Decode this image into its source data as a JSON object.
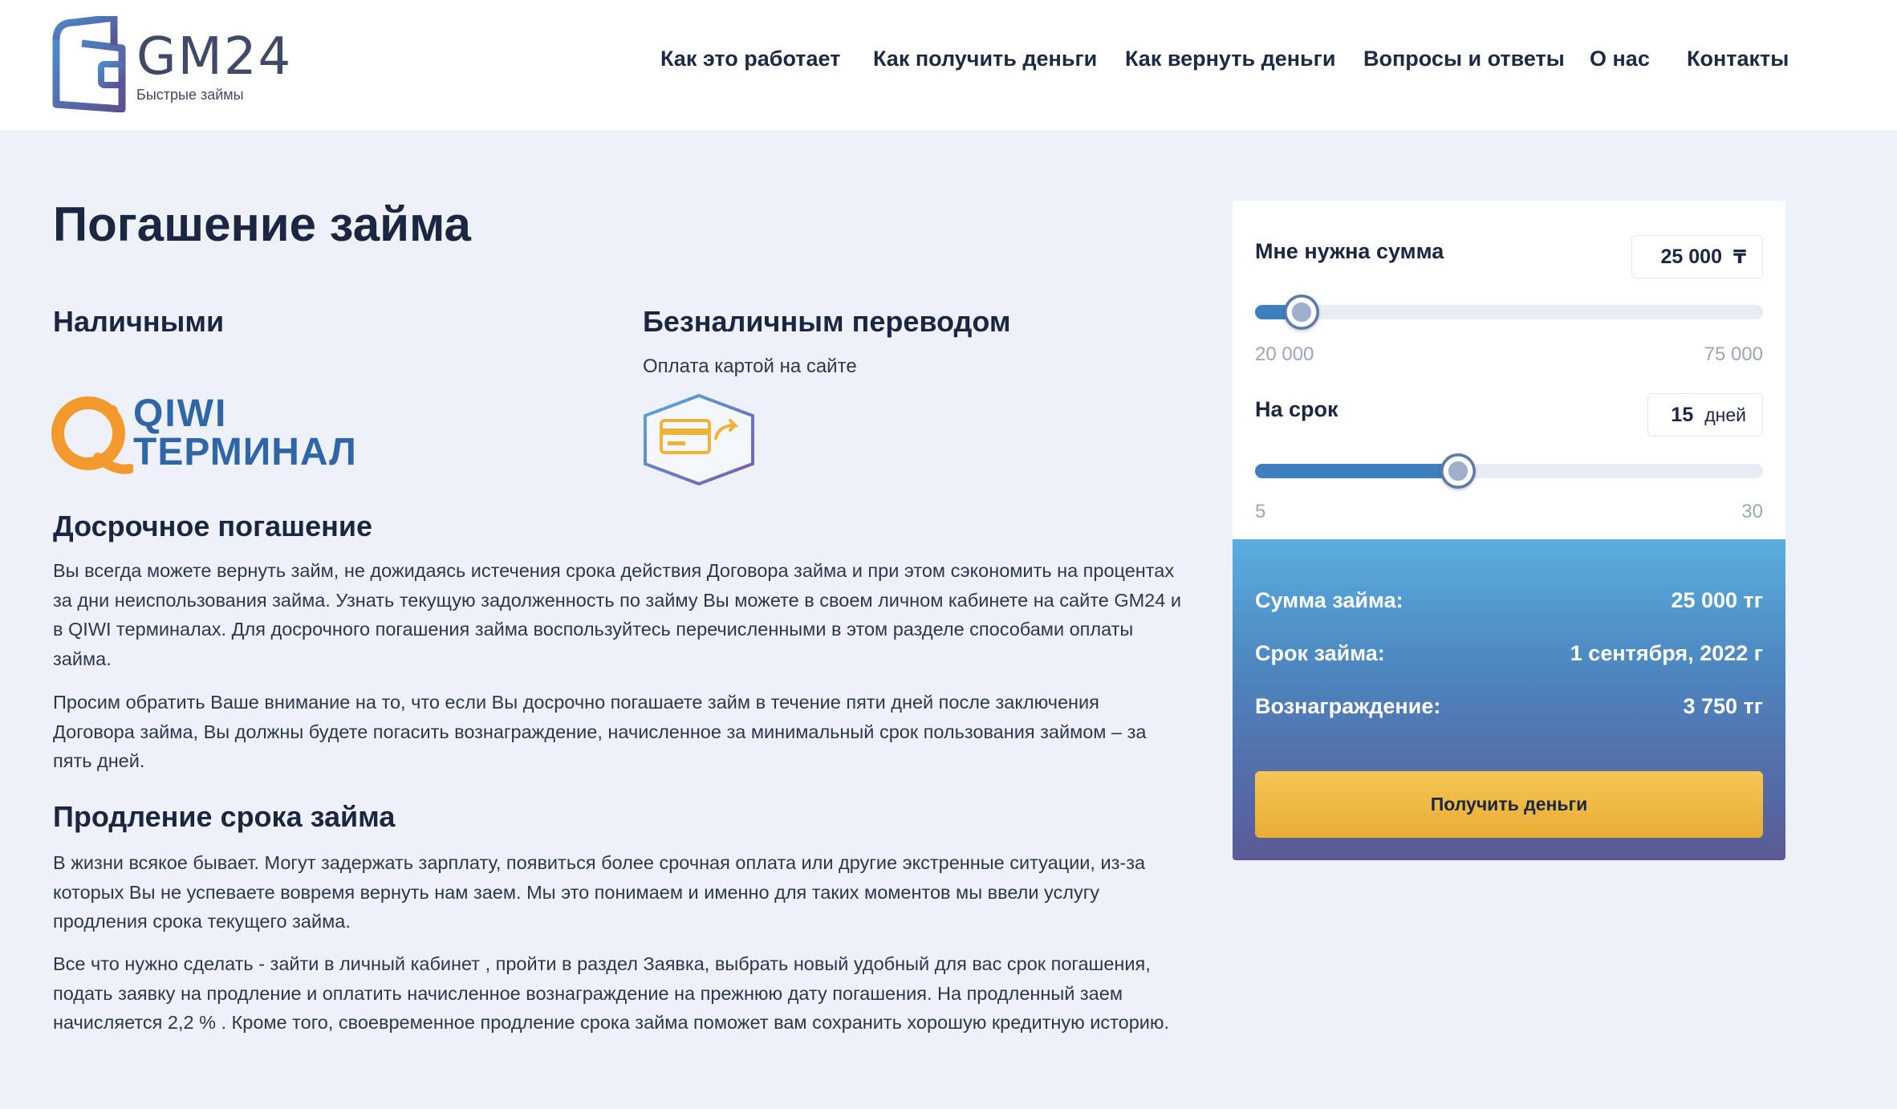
{
  "brand": {
    "name": "GM24",
    "tagline": "Быстрые займы"
  },
  "nav": {
    "items": [
      {
        "label": "Как это работает"
      },
      {
        "label": "Как получить деньги"
      },
      {
        "label": "Как вернуть деньги"
      },
      {
        "label": "Вопросы и ответы"
      },
      {
        "label": "О нас"
      },
      {
        "label": "Контакты"
      }
    ]
  },
  "main": {
    "title": "Погашение займа",
    "cash": {
      "heading": "Наличными",
      "logo_line1": "QIWI",
      "logo_line2": "ТЕРМИНАЛ"
    },
    "cashless": {
      "heading": "Безналичным переводом",
      "subtitle": "Оплата картой на сайте",
      "icon": "card-transfer-icon"
    },
    "early": {
      "heading": "Досрочное погашение",
      "p1": "Вы всегда можете вернуть займ, не дожидаясь истечения срока действия Договора займа и при этом сэкономить на процентах за дни неиспользования займа. Узнать текущую задолженность по займу Вы можете в своем личном кабинете на сайте GM24 и в QIWI терминалах. Для досрочного погашения займа воспользуйтесь перечисленными в этом разделе способами оплаты займа.",
      "p2": "Просим обратить Ваше внимание на то, что если Вы досрочно погашаете займ в течение пяти дней после заключения Договора займа, Вы должны будете погасить вознаграждение, начисленное за минимальный срок пользования займом – за пять дней."
    },
    "extend": {
      "heading": "Продление срока займа",
      "p1": "В жизни всякое бывает. Могут задержать зарплату, появиться более срочная оплата или другие экстренные ситуации, из-за которых Вы не успеваете вовремя вернуть нам заем. Мы это понимаем и именно для таких моментов мы ввели услугу продления срока текущего займа.",
      "p2": "Все что нужно сделать - зайти в личный кабинет , пройти в раздел Заявка, выбрать новый удобный для вас срок погашения, подать заявку на продление и оплатить начисленное вознаграждение на прежнюю дату погашения. На продленный заем начисляется 2,2 % . Кроме того, своевременное продление срока займа поможет вам сохранить хорошую кредитную историю."
    }
  },
  "calculator": {
    "amount_label": "Мне нужна сумма",
    "amount_value": "25 000",
    "amount_unit": "₸",
    "amount_min": "20 000",
    "amount_max": "75 000",
    "amount_level": 0.091,
    "term_label": "На срок",
    "term_value": "15",
    "term_unit": "дней",
    "term_min": "5",
    "term_max": "30",
    "term_level": 0.4,
    "summary": {
      "sum_label": "Сумма займа:",
      "sum_value": "25 000 тг",
      "date_label": "Срок займа:",
      "date_value": "1 сентября, 2022 г",
      "reward_label": "Вознаграждение:",
      "reward_value": "3 750 тг"
    },
    "cta_label": "Получить деньги"
  },
  "colors": {
    "brand_dark": "#1b2742",
    "accent_blue": "#3f7fc0",
    "cta_yellow": "#f0bb45",
    "qiwi_orange": "#f39a2e"
  }
}
